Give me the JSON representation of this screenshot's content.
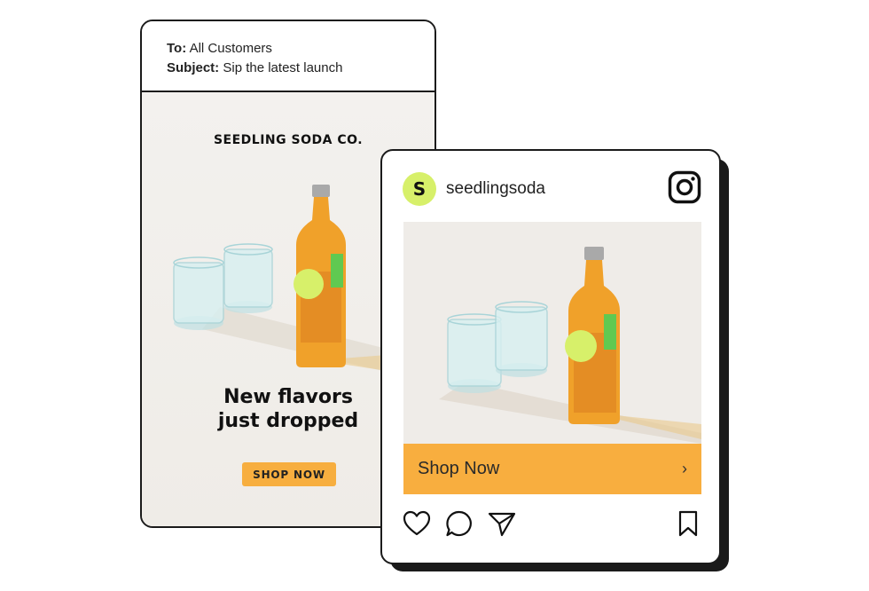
{
  "email": {
    "to_label": "To:",
    "to_value": "All Customers",
    "subject_label": "Subject:",
    "subject_value": "Sip the latest launch",
    "brand": "SEEDLING SODA CO.",
    "headline": "New flavors\njust dropped",
    "cta": "SHOP NOW"
  },
  "instagram": {
    "avatar_letter": "S",
    "handle": "seedlingsoda",
    "cta": "Shop Now",
    "cta_chevron": "›",
    "actions": [
      "heart-icon",
      "comment-icon",
      "share-icon",
      "bookmark-icon"
    ]
  },
  "colors": {
    "accent_orange": "#f8ae3f",
    "avatar_lime": "#d7f06a",
    "outline": "#1b1b1b",
    "soda": "#f0a12a"
  }
}
